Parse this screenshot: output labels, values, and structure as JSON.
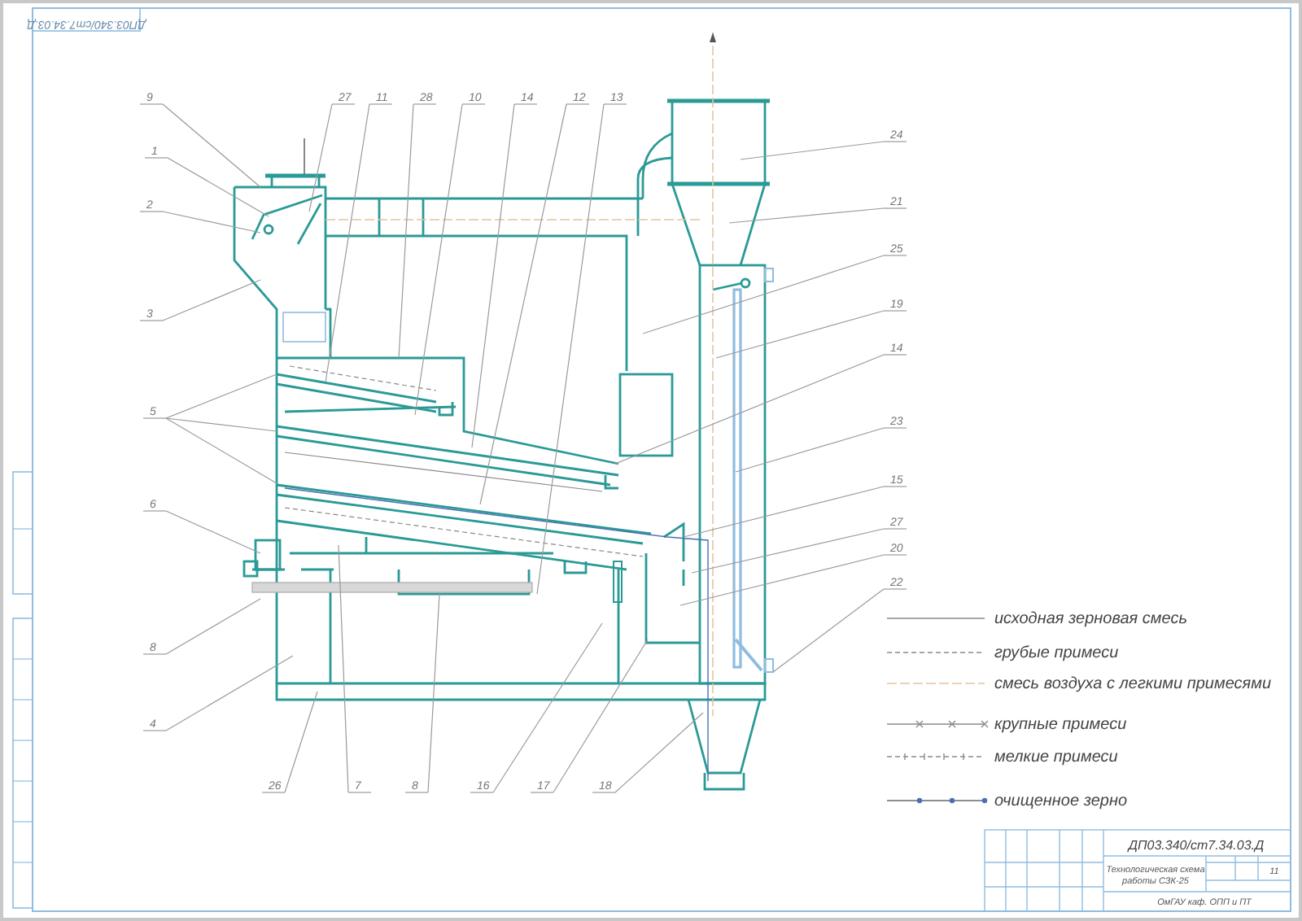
{
  "corner_stamp": "ДП03.340/ст7.34.03.Д",
  "callouts": [
    "9",
    "1",
    "2",
    "3",
    "5",
    "6",
    "8",
    "4",
    "27",
    "11",
    "28",
    "10",
    "14",
    "12",
    "13",
    "24",
    "21",
    "25",
    "19",
    "14",
    "23",
    "15",
    "27",
    "20",
    "22",
    "26",
    "7",
    "8",
    "16",
    "17",
    "18"
  ],
  "legend": [
    {
      "kind": "solid",
      "label": "исходная зерновая смесь"
    },
    {
      "kind": "dashed",
      "label": "грубые примеси"
    },
    {
      "kind": "air",
      "label": "смесь воздуха с легкими примесями"
    },
    {
      "kind": "coarse",
      "label": "крупные примеси"
    },
    {
      "kind": "fine",
      "label": "мелкие примеси"
    },
    {
      "kind": "clean",
      "label": "очищенное зерно"
    }
  ],
  "title_block": {
    "designation": "ДП03.340/ст7.34.03.Д",
    "title_lines": [
      "Технологическая схема",
      "работы СЗК-25"
    ],
    "scale": "11",
    "organization": "ОмГАУ каф. ОПП и ПТ"
  }
}
